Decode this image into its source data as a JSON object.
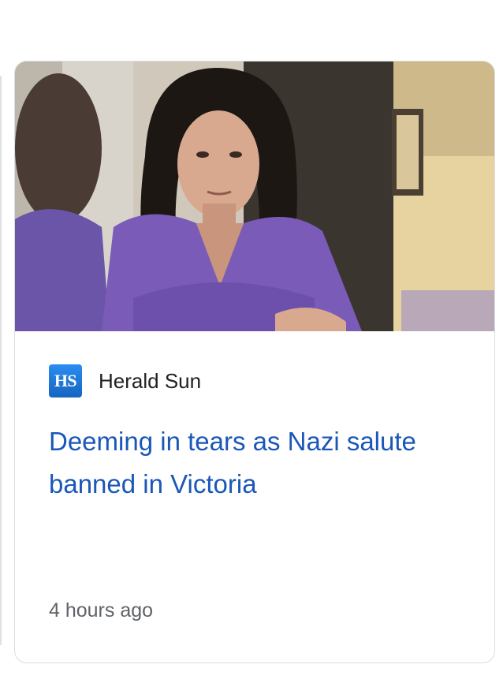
{
  "card": {
    "thumbnail": {
      "subject": "news-photo"
    },
    "source": {
      "logo_text": "HS",
      "name": "Herald Sun",
      "logo_color": "#1a73e8"
    },
    "headline": "Deeming in tears as Nazi salute banned in Victoria",
    "timestamp": "4 hours ago",
    "headline_color": "#1a57b8"
  }
}
